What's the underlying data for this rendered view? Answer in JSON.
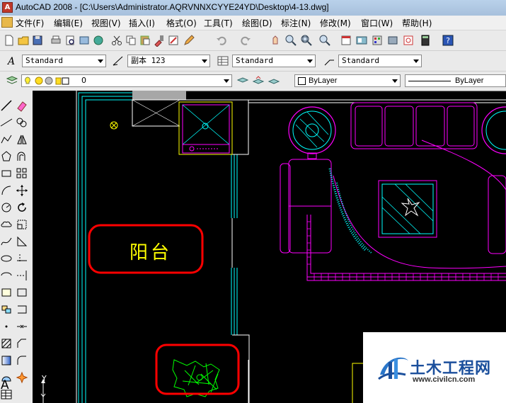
{
  "window": {
    "title": "AutoCAD 2008 - [C:\\Users\\Administrator.AQRVNNXCYYE24YD\\Desktop\\4-13.dwg]"
  },
  "menu": [
    "文件(F)",
    "编辑(E)",
    "视图(V)",
    "插入(I)",
    "格式(O)",
    "工具(T)",
    "绘图(D)",
    "标注(N)",
    "修改(M)",
    "窗口(W)",
    "帮助(H)"
  ],
  "styles_toolbar": {
    "text_style": "Standard",
    "dim_style": "副本 123",
    "table_style": "Standard",
    "mleader_style": "Standard"
  },
  "layers_toolbar": {
    "layer": "0",
    "color": "ByLayer",
    "linetype": "ByLayer"
  },
  "drawing": {
    "room_label": "阳台"
  },
  "ucs": {
    "y_axis": "Y"
  },
  "left_toolbar_letter": "A",
  "watermark": {
    "name": "土木工程网",
    "url": "www.civilcn.com"
  },
  "colors": {
    "cyan": "#00ffff",
    "magenta": "#ff00ff",
    "yellow": "#ffff00",
    "green": "#00ff00",
    "red": "#ff0000",
    "white": "#ffffff"
  }
}
